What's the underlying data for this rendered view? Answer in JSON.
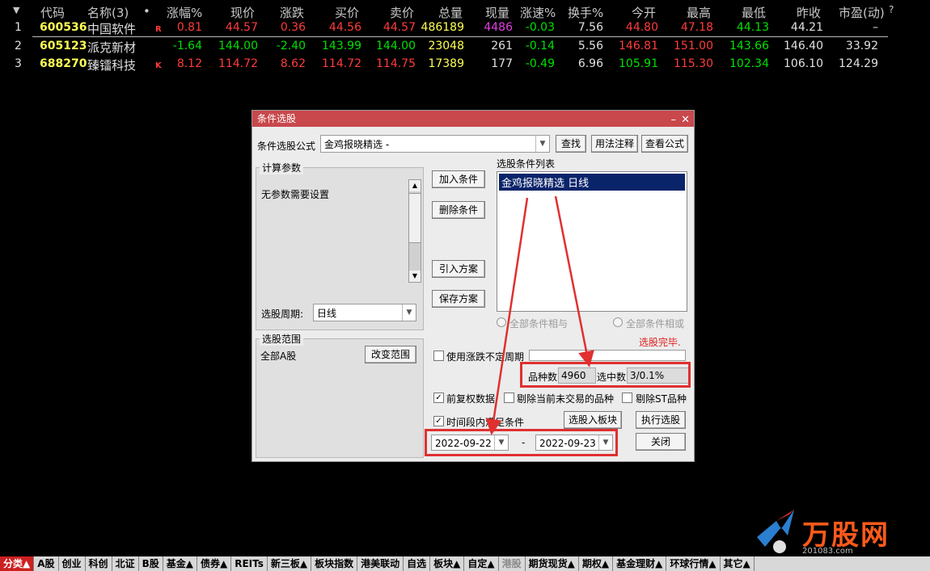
{
  "table": {
    "headers": [
      "代码",
      "名称(3)",
      "•",
      "涨幅%",
      "现价",
      "涨跌",
      "买价",
      "卖价",
      "总量",
      "现量",
      "涨速%",
      "换手%",
      "今开",
      "最高",
      "最低",
      "昨收",
      "市盈(动)",
      "?"
    ],
    "rows": [
      {
        "idx": "1",
        "code": "600536",
        "name": "中国软件",
        "mark": "R",
        "chg_pct": "0.81",
        "price": "44.57",
        "chg": "0.36",
        "bid": "44.56",
        "ask": "44.57",
        "volume": "486189",
        "cur_vol": "4486",
        "speed": "-0.03",
        "turnover": "7.56",
        "open": "44.80",
        "high": "47.18",
        "low": "44.13",
        "prev_close": "44.21",
        "pe": "–"
      },
      {
        "idx": "2",
        "code": "605123",
        "name": "派克新材",
        "mark": "",
        "chg_pct": "-1.64",
        "price": "144.00",
        "chg": "-2.40",
        "bid": "143.99",
        "ask": "144.00",
        "volume": "23048",
        "cur_vol": "261",
        "speed": "-0.14",
        "turnover": "5.56",
        "open": "146.81",
        "high": "151.00",
        "low": "143.66",
        "prev_close": "146.40",
        "pe": "33.92"
      },
      {
        "idx": "3",
        "code": "688270",
        "name": "臻镭科技",
        "mark": "K",
        "chg_pct": "8.12",
        "price": "114.72",
        "chg": "8.62",
        "bid": "114.72",
        "ask": "114.75",
        "volume": "17389",
        "cur_vol": "177",
        "speed": "-0.49",
        "turnover": "6.96",
        "open": "105.91",
        "high": "115.30",
        "low": "102.34",
        "prev_close": "106.10",
        "pe": "124.29"
      }
    ]
  },
  "dialog": {
    "title": "条件选股",
    "formula_label": "条件选股公式",
    "formula_value": "金鸡报晓精选 -",
    "find_btn": "查找",
    "usage_btn": "用法注释",
    "view_formula_btn": "查看公式",
    "calc_params_label": "计算参数",
    "no_params_text": "无参数需要设置",
    "add_cond_btn": "加入条件",
    "del_cond_btn": "删除条件",
    "import_plan_btn": "引入方案",
    "save_plan_btn": "保存方案",
    "cond_list_label": "选股条件列表",
    "cond_list_items": [
      "金鸡报晓精选  日线"
    ],
    "radio_all_and": "全部条件相与",
    "radio_all_or": "全部条件相或",
    "status_done": "选股完毕.",
    "period_label": "选股周期:",
    "period_value": "日线",
    "scope_label": "选股范围",
    "scope_value": "全部A股",
    "change_scope_btn": "改变范围",
    "use_indefinite_period": "使用涨跌不定周期",
    "variety_count_label": "品种数",
    "variety_count": "4960",
    "selected_count_label": "选中数",
    "selected_count": "3/0.1%",
    "forward_adjust": "前复权数据",
    "exclude_untraded": "剔除当前未交易的品种",
    "exclude_st": "剔除ST品种",
    "time_range_cond": "时间段内满足条件",
    "to_block_btn": "选股入板块",
    "execute_btn": "执行选股",
    "close_btn": "关闭",
    "date_from": "2022-09-22",
    "date_sep": "-",
    "date_to": "2022-09-23"
  },
  "tabs": [
    "分类▲",
    "A股",
    "创业",
    "科创",
    "北证",
    "B股",
    "基金▲",
    "债券▲",
    "REITs",
    "新三板▲",
    "板块指数",
    "港美联动",
    "自选",
    "板块▲",
    "自定▲",
    "港股",
    "期货现货▲",
    "期权▲",
    "基金理财▲",
    "环球行情▲",
    "其它▲"
  ],
  "logo": {
    "text": "万股网",
    "url": "201083.com"
  },
  "colors": {
    "up": "#ff3b3b",
    "down": "#00e000",
    "title_bar": "#c8484c",
    "highlight_box": "#e03030"
  }
}
